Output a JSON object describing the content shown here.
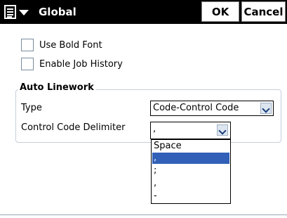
{
  "titlebar": {
    "title": "Global",
    "menu_icon": "doc-menu-icon",
    "ok_label": "OK",
    "cancel_label": "Cancel"
  },
  "options": {
    "use_bold_font": {
      "label": "Use Bold Font",
      "checked": false
    },
    "enable_job_history": {
      "label": "Enable Job History",
      "checked": false
    }
  },
  "auto_linework": {
    "group_title": "Auto Linework",
    "type_label": "Type",
    "type_value": "Code-Control Code",
    "delimiter_label": "Control Code Delimiter",
    "delimiter_value": ",",
    "delimiter_options": [
      "Space",
      ",",
      ";",
      ",",
      "-"
    ],
    "delimiter_selected_index": 1
  },
  "colors": {
    "titlebar_bg": "#000000",
    "selection": "#3260b8",
    "group_border": "#c4cfdb"
  }
}
